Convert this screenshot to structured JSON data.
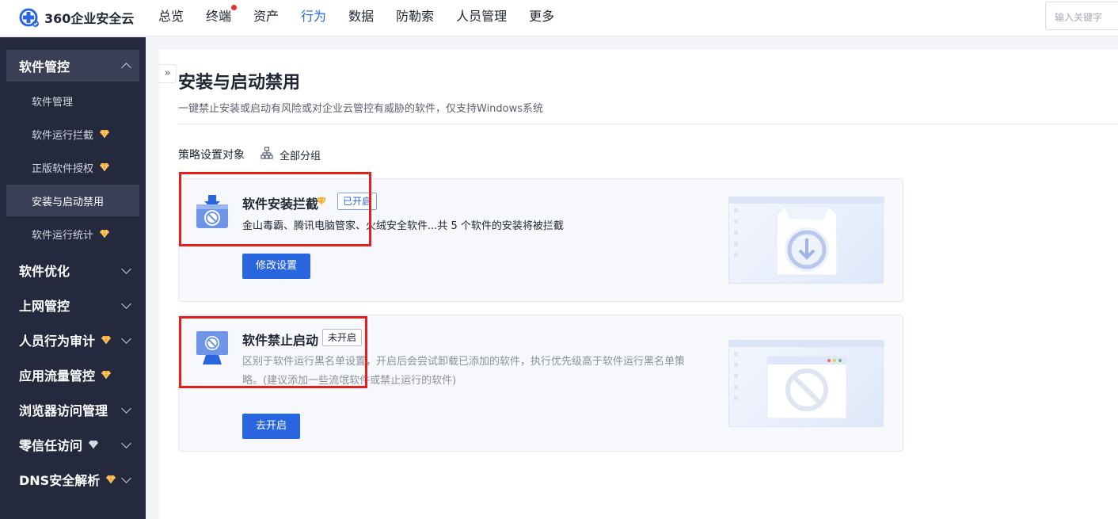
{
  "header": {
    "logo_text": "360企业安全云",
    "nav": [
      {
        "label": "总览",
        "active": false,
        "dot": false
      },
      {
        "label": "终端",
        "active": false,
        "dot": true
      },
      {
        "label": "资产",
        "active": false,
        "dot": false
      },
      {
        "label": "行为",
        "active": true,
        "dot": false
      },
      {
        "label": "数据",
        "active": false,
        "dot": false
      },
      {
        "label": "防勒索",
        "active": false,
        "dot": false
      },
      {
        "label": "人员管理",
        "active": false,
        "dot": false
      },
      {
        "label": "更多",
        "active": false,
        "dot": false
      }
    ],
    "search_placeholder": "输入关键字"
  },
  "sidebar": {
    "group_software_control": "软件管控",
    "sub_items": [
      {
        "label": "软件管理",
        "gem": false,
        "active": false
      },
      {
        "label": "软件运行拦截",
        "gem": true,
        "active": false
      },
      {
        "label": "正版软件授权",
        "gem": true,
        "active": false
      },
      {
        "label": "安装与启动禁用",
        "gem": false,
        "active": true
      },
      {
        "label": "软件运行统计",
        "gem": true,
        "active": false
      }
    ],
    "groups": [
      {
        "label": "软件优化",
        "gem": false,
        "gem_color": "",
        "chevron": true
      },
      {
        "label": "上网管控",
        "gem": false,
        "gem_color": "",
        "chevron": true
      },
      {
        "label": "人员行为审计",
        "gem": true,
        "gem_color": "#f5a623",
        "chevron": true
      },
      {
        "label": "应用流量管控",
        "gem": true,
        "gem_color": "#f5a623",
        "chevron": false
      },
      {
        "label": "浏览器访问管理",
        "gem": false,
        "gem_color": "",
        "chevron": true
      },
      {
        "label": "零信任访问",
        "gem": true,
        "gem_color": "#c9ccd6",
        "chevron": true
      },
      {
        "label": "DNS安全解析",
        "gem": true,
        "gem_color": "#f5a623",
        "chevron": true
      }
    ]
  },
  "main": {
    "title": "安装与启动禁用",
    "description": "一键禁止安装或启动有风险或对企业云管控有威胁的软件，仅支持Windows系统",
    "policy_target_label": "策略设置对象",
    "policy_target_value": "全部分组",
    "cards": [
      {
        "title": "软件安装拦截",
        "status": "已开启",
        "description": "金山毒霸、腾讯电脑管家、火绒安全软件...共 5 个软件的安装将被拦截",
        "button": "修改设置"
      },
      {
        "title": "软件禁止启动",
        "status": "未开启",
        "description": "区别于软件运行黑名单设置，开启后会尝试卸载已添加的软件，执行优先级高于软件运行黑名单策略。(建议添加一些流氓软件或禁止运行的软件)",
        "button": "去开启"
      }
    ]
  },
  "colors": {
    "accent": "#2a65e0",
    "sidebar_bg": "#25293d",
    "gem_gold": "#f5a623",
    "highlight_red": "#e5201b"
  },
  "icons": {
    "collapse": "double-chevron-right-icon",
    "tree": "org-tree-icon",
    "premium": "diamond-icon",
    "install_block": "download-ban-icon",
    "launch_block": "monitor-ban-icon"
  }
}
